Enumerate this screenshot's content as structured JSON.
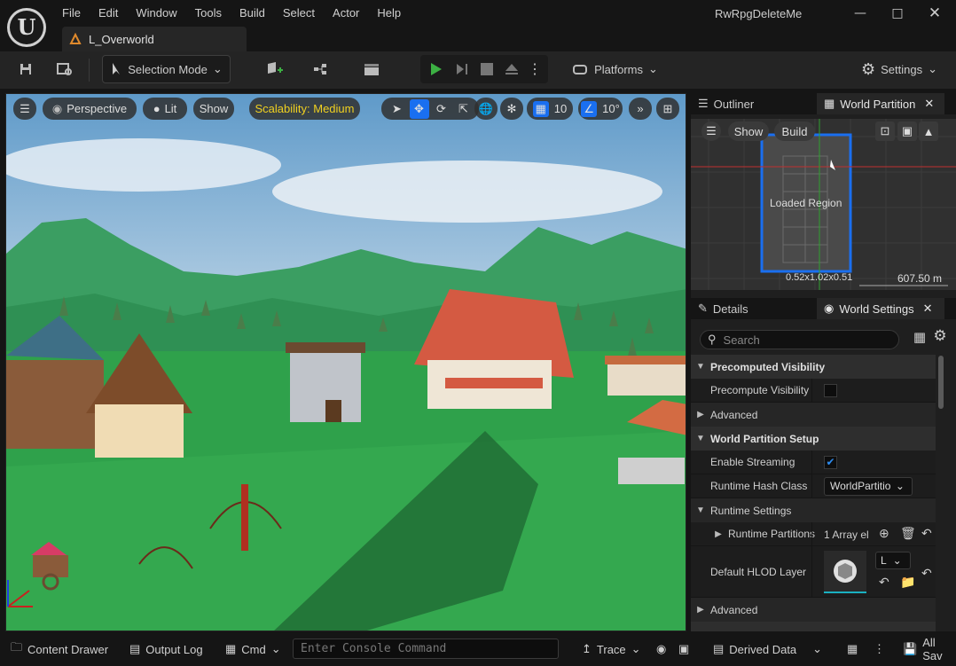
{
  "menu": [
    "File",
    "Edit",
    "Window",
    "Tools",
    "Build",
    "Select",
    "Actor",
    "Help"
  ],
  "app_title": "RwRpgDeleteMe",
  "doc_tab": "L_Overworld",
  "toolbar": {
    "selection_mode": "Selection Mode",
    "platforms": "Platforms",
    "settings": "Settings"
  },
  "viewport": {
    "perspective": "Perspective",
    "lit": "Lit",
    "show": "Show",
    "scalability": "Scalability: Medium",
    "grid_snap": "10",
    "rotation_snap": "10°"
  },
  "panel_top": {
    "tab_outliner": "Outliner",
    "tab_world_partition": "World Partition",
    "show": "Show",
    "build": "Build",
    "loaded_region": "Loaded Region",
    "dims": "0.52x1.02x0.51",
    "scale": "607.50 m"
  },
  "panel_bottom": {
    "tab_details": "Details",
    "tab_world_settings": "World Settings",
    "search_placeholder": "Search"
  },
  "rows": {
    "precomputed_visibility": "Precomputed Visibility",
    "precompute_visibility": "Precompute Visibility",
    "advanced": "Advanced",
    "world_partition_setup": "World Partition Setup",
    "enable_streaming": "Enable Streaming",
    "runtime_hash_class": "Runtime Hash Class",
    "runtime_hash_value": "WorldPartitio",
    "runtime_settings": "Runtime Settings",
    "runtime_partitions": "Runtime Partitions",
    "runtime_partitions_value": "1 Array el",
    "default_hlod_layer": "Default HLOD Layer",
    "hlod_dropdown": "L",
    "advanced2": "Advanced"
  },
  "checkbox_states": {
    "precompute_visibility": false,
    "enable_streaming": true
  },
  "status": {
    "content_drawer": "Content Drawer",
    "output_log": "Output Log",
    "cmd": "Cmd",
    "console_placeholder": "Enter Console Command",
    "trace": "Trace",
    "derived_data": "Derived Data",
    "all_saved": "All Sav"
  },
  "colors": {
    "accent": "#0070e0",
    "play": "#3cb043",
    "scalability": "#f0d020",
    "selection_blue": "#1a6ff0"
  }
}
